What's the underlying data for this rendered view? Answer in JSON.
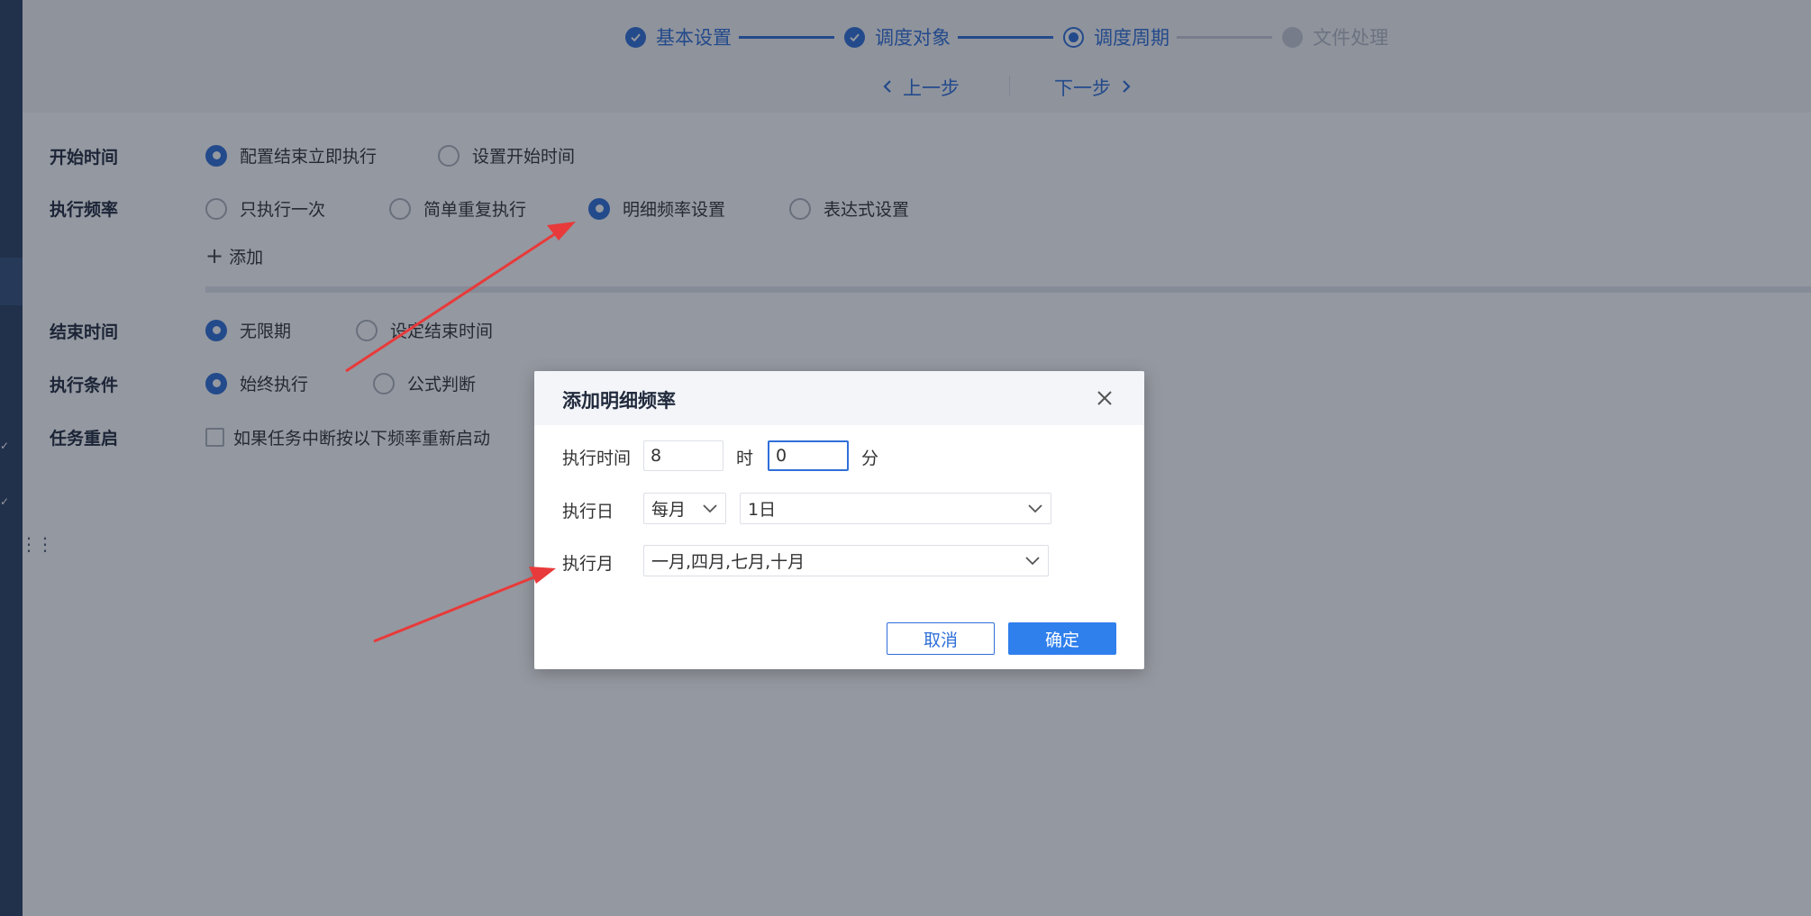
{
  "steps": [
    {
      "label": "基本设置",
      "state": "done"
    },
    {
      "label": "调度对象",
      "state": "done"
    },
    {
      "label": "调度周期",
      "state": "current"
    },
    {
      "label": "文件处理",
      "state": "todo"
    }
  ],
  "nav": {
    "prev": "上一步",
    "next": "下一步"
  },
  "form": {
    "start_time": {
      "label": "开始时间",
      "options": [
        "配置结束立即执行",
        "设置开始时间"
      ],
      "selected": 0
    },
    "frequency": {
      "label": "执行频率",
      "options": [
        "只执行一次",
        "简单重复执行",
        "明细频率设置",
        "表达式设置"
      ],
      "selected": 2
    },
    "add_label": "添加",
    "end_time": {
      "label": "结束时间",
      "options": [
        "无限期",
        "设定结束时间"
      ],
      "selected": 0
    },
    "condition": {
      "label": "执行条件",
      "options": [
        "始终执行",
        "公式判断"
      ],
      "selected": 0
    },
    "restart": {
      "label": "任务重启",
      "checkbox_label": "如果任务中断按以下频率重新启动",
      "checked": false
    }
  },
  "dialog": {
    "title": "添加明细频率",
    "time_label": "执行时间",
    "hour_value": "8",
    "hour_unit": "时",
    "minute_value": "0",
    "minute_unit": "分",
    "day_label": "执行日",
    "day_period": "每月",
    "day_value": "1日",
    "month_label": "执行月",
    "month_value": "一月,四月,七月,十月",
    "cancel": "取消",
    "confirm": "确定"
  },
  "colors": {
    "accent": "#2f6fd8",
    "annotation_arrow": "#e83a3a"
  }
}
